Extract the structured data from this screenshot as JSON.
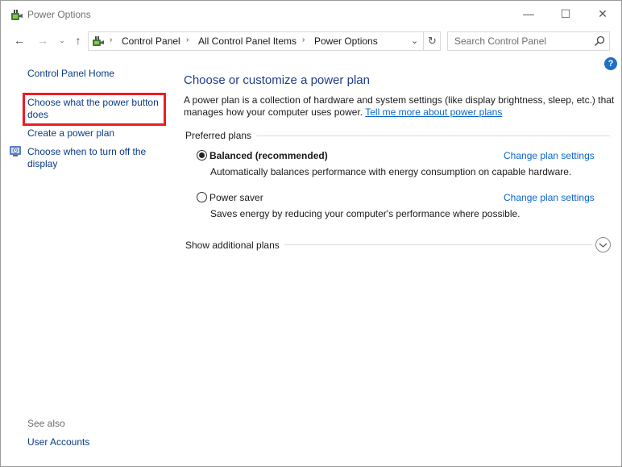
{
  "window": {
    "title": "Power Options",
    "icon": "power-options-icon",
    "controls": {
      "minimize": "—",
      "maximize": "☐",
      "close": "✕"
    }
  },
  "nav": {
    "back": "←",
    "forward": "→",
    "recent": "⌄",
    "up": "↑"
  },
  "address": {
    "crumbs": [
      "Control Panel",
      "All Control Panel Items",
      "Power Options"
    ],
    "separator": "›",
    "dropdown": "⌄",
    "refresh": "↻"
  },
  "search": {
    "placeholder": "Search Control Panel"
  },
  "help": {
    "label": "?"
  },
  "sidebar": {
    "home": "Control Panel Home",
    "links": [
      {
        "label": "Choose what the power button\ndoes",
        "highlighted": true
      },
      {
        "label": "Create a power plan"
      },
      {
        "label": "Choose when to turn off the\ndisplay",
        "icon": "clock-icon"
      }
    ],
    "see_also": {
      "heading": "See also",
      "links": [
        "User Accounts"
      ]
    }
  },
  "main": {
    "title": "Choose or customize a power plan",
    "intro": "A power plan is a collection of hardware and system settings (like display brightness, sleep, etc.) that manages how your computer uses power.",
    "intro_link": "Tell me more about power plans",
    "preferred_heading": "Preferred plans",
    "plans": [
      {
        "name": "Balanced (recommended)",
        "selected": true,
        "description": "Automatically balances performance with energy consumption on capable hardware.",
        "link": "Change plan settings"
      },
      {
        "name": "Power saver",
        "selected": false,
        "description": "Saves energy by reducing your computer's performance where possible.",
        "link": "Change plan settings"
      }
    ],
    "additional_plans": "Show additional plans"
  },
  "colors": {
    "link": "#0b3a86",
    "main_title": "#1e3d8c",
    "highlight_box": "#ee1c24"
  }
}
